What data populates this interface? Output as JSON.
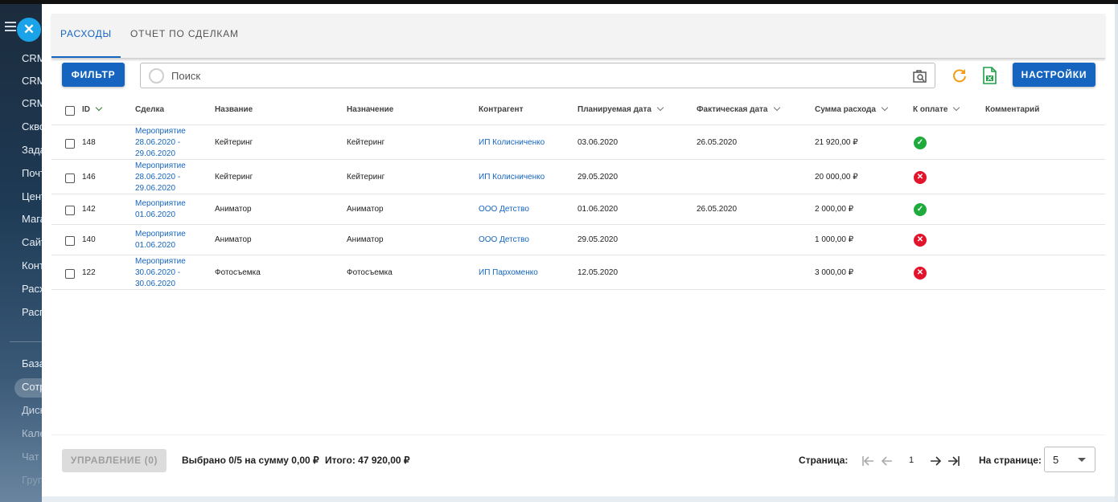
{
  "background_sidebar": {
    "items": [
      "CRM",
      "CRM",
      "CRM",
      "Скво",
      "Зада",
      "Почт",
      "Цент",
      "Мага",
      "Сайт",
      "Конт",
      "Расх",
      "Расп",
      "База",
      "Сотр",
      "Диск",
      "Кале",
      "Чат",
      "Груп"
    ]
  },
  "tabs": [
    {
      "label": "РАСХОДЫ",
      "active": true
    },
    {
      "label": "ОТЧЕТ ПО СДЕЛКАМ",
      "active": false
    }
  ],
  "toolbar": {
    "filter_label": "ФИЛЬТР",
    "search_placeholder": "Поиск",
    "settings_label": "НАСТРОЙКИ"
  },
  "table": {
    "columns": {
      "id": "ID",
      "deal": "Сделка",
      "name": "Название",
      "purpose": "Назначение",
      "contractor": "Контрагент",
      "planned_date": "Планируемая дата",
      "actual_date": "Фактическая дата",
      "sum": "Сумма расхода",
      "to_pay": "К оплате",
      "comment": "Комментарий"
    },
    "rows": [
      {
        "id": "148",
        "deal_line1": "Мероприятие",
        "deal_line2": "28.06.2020 -",
        "deal_line3": "29.06.2020",
        "name": "Кейтеринг",
        "purpose": "Кейтеринг",
        "contractor": "ИП Колисниченко",
        "planned_date": "03.06.2020",
        "actual_date": "26.05.2020",
        "sum": "21 920,00 ₽",
        "to_pay": "yes",
        "comment": ""
      },
      {
        "id": "146",
        "deal_line1": "Мероприятие",
        "deal_line2": "28.06.2020 -",
        "deal_line3": "29.06.2020",
        "name": "Кейтеринг",
        "purpose": "Кейтеринг",
        "contractor": "ИП Колисниченко",
        "planned_date": "29.05.2020",
        "actual_date": "",
        "sum": "20 000,00 ₽",
        "to_pay": "no",
        "comment": ""
      },
      {
        "id": "142",
        "deal_line1": "Мероприятие",
        "deal_line2": "01.06.2020",
        "deal_line3": "",
        "name": "Аниматор",
        "purpose": "Аниматор",
        "contractor": "ООО Детство",
        "planned_date": "01.06.2020",
        "actual_date": "26.05.2020",
        "sum": "2 000,00 ₽",
        "to_pay": "yes",
        "comment": ""
      },
      {
        "id": "140",
        "deal_line1": "Мероприятие",
        "deal_line2": "01.06.2020",
        "deal_line3": "",
        "name": "Аниматор",
        "purpose": "Аниматор",
        "contractor": "ООО Детство",
        "planned_date": "29.05.2020",
        "actual_date": "",
        "sum": "1 000,00 ₽",
        "to_pay": "no",
        "comment": ""
      },
      {
        "id": "122",
        "deal_line1": "Мероприятие",
        "deal_line2": "30.06.2020 -",
        "deal_line3": "30.06.2020",
        "name": "Фотосъемка",
        "purpose": "Фотосъемка",
        "contractor": "ИП Пархоменко",
        "planned_date": "12.05.2020",
        "actual_date": "",
        "sum": "3 000,00 ₽",
        "to_pay": "no",
        "comment": ""
      }
    ]
  },
  "footer": {
    "manage_label": "УПРАВЛЕНИЕ (0)",
    "selected_text": "Выбрано 0/5 на сумму 0,00 ₽",
    "total_text": "Итого: 47 920,00 ₽",
    "page_label": "Страница:",
    "current_page": "1",
    "per_page_label": "На странице:",
    "per_page_value": "5"
  },
  "colors": {
    "accent": "#1565c0",
    "ok": "#1faa3c",
    "error": "#e3132c",
    "refresh": "#f39c12",
    "excel": "#21a04a"
  }
}
